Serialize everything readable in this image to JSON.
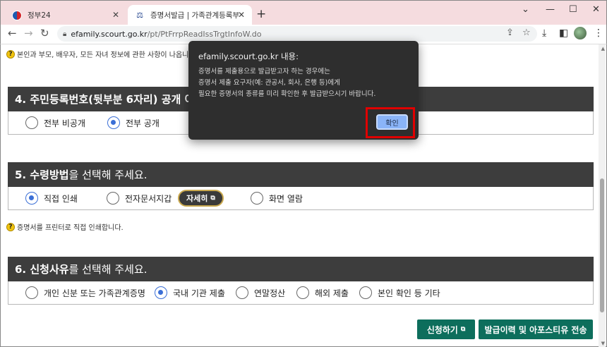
{
  "browser": {
    "tabs": [
      {
        "title": "정부24",
        "active": false
      },
      {
        "title": "증명서발급 | 가족관계등록부 | ",
        "active": true
      }
    ],
    "url_host": "efamily.scourt.go.kr",
    "url_path": "/pt/PtFrrpReadIssTrgtInfoW.do"
  },
  "page": {
    "top_notice": "본인과 부모, 배우자, 모든 자녀 정보에 관한 사항이 나옵니",
    "section4": {
      "title_bold": "4. 주민등록번호(뒷부분 6자리) 공개 여부",
      "options": [
        {
          "label": "전부 비공개",
          "selected": false
        },
        {
          "label": "전부 공개",
          "selected": true
        }
      ]
    },
    "section5": {
      "title_bold": "5. 수령방법",
      "title_rest": "을 선택해 주세요.",
      "options": [
        {
          "label": "직접 인쇄",
          "selected": true
        },
        {
          "label": "전자문서지갑",
          "selected": false
        },
        {
          "label": "화면 열람",
          "selected": false
        }
      ],
      "detail_button": "자세히",
      "notice": "증명서를 프린터로 직접 인쇄합니다."
    },
    "section6": {
      "title_bold": "6. 신청사유",
      "title_rest": "를 선택해 주세요.",
      "options": [
        {
          "label": "개인 신분 또는 가족관계증명",
          "selected": false
        },
        {
          "label": "국내 기관 제출",
          "selected": true
        },
        {
          "label": "연말정산",
          "selected": false
        },
        {
          "label": "해외 제출",
          "selected": false
        },
        {
          "label": "본인 확인 등 기타",
          "selected": false
        }
      ]
    },
    "buttons": {
      "apply": "신청하기",
      "history": "발급이력 및 아포스티유 전송"
    }
  },
  "dialog": {
    "title": "efamily.scourt.go.kr 내용:",
    "lines": [
      "증명서를 제출용으로 발급받고자 하는 경우에는",
      "증명서 제출 요구자(예: 관공서, 회사, 은행 등)에게",
      "필요한 증명서의 종류를 미리 확인한 후 발급받으시기 바랍니다."
    ],
    "ok": "확인"
  },
  "colors": {
    "section_header": "#3d3d3d",
    "accent_green": "#0d6e5c",
    "radio_selected": "#3b6fd6",
    "highlight": "#e00000"
  }
}
